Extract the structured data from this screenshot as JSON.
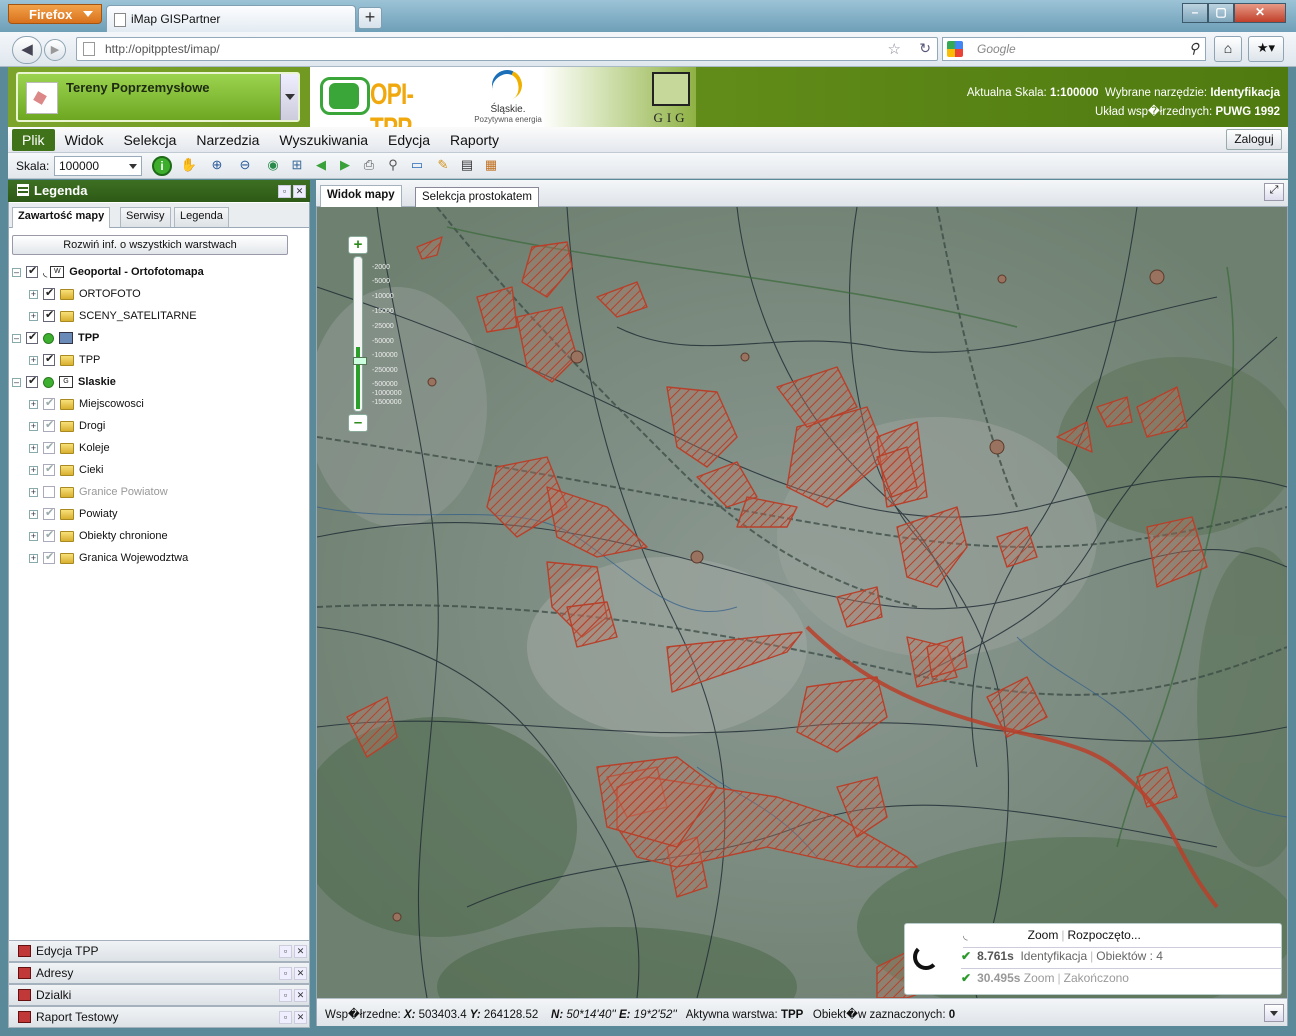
{
  "browser": {
    "app_button": "Firefox",
    "tab_title": "iMap GISPartner",
    "new_tab": "+",
    "url": "http://opitpptest/imap/",
    "search_placeholder": "Google"
  },
  "header": {
    "layer_selector": "Tereny Poprzemysłowe",
    "logo_opi": "OPI-TPP",
    "logo_slaskie_1": "Śląskie.",
    "logo_slaskie_2": "Pozytywna energia",
    "logo_gig": "GIG",
    "scale_label": "Aktualna Skala:",
    "scale_value": "1:100000",
    "tool_label": "Wybrane narzędzie:",
    "tool_value": "Identyfikacja",
    "crs_label": "Układ wsp�łrzednych:",
    "crs_value": "PUWG 1992"
  },
  "menu": {
    "items": [
      "Plik",
      "Widok",
      "Selekcja",
      "Narzedzia",
      "Wyszukiwania",
      "Edycja",
      "Raporty"
    ],
    "login": "Zaloguj"
  },
  "toolbar": {
    "scale_label": "Skala:",
    "scale_value": "100000"
  },
  "legend": {
    "title": "Legenda",
    "tabs": [
      "Zawartość mapy",
      "Serwisy",
      "Legenda"
    ],
    "expand_button": "Rozwiń inf. o wszystkich warstwach",
    "groups": [
      {
        "label": "Geoportal - Ortofotomapa",
        "children": [
          "ORTOFOTO",
          "SCENY_SATELITARNE"
        ]
      },
      {
        "label": "TPP",
        "children": [
          "TPP"
        ]
      },
      {
        "label": "Slaskie",
        "children": [
          "Miejscowosci",
          "Drogi",
          "Koleje",
          "Cieki",
          "Granice Powiatow",
          "Powiaty",
          "Obiekty chronione",
          "Granica Wojewodztwa"
        ]
      }
    ]
  },
  "bottom_panels": [
    "Edycja TPP",
    "Adresy",
    "Dzialki",
    "Raport Testowy"
  ],
  "map": {
    "tabs": [
      "Widok mapy",
      "Selekcja prostokatem"
    ],
    "zoom_labels": [
      "-2000",
      "-5000",
      "-10000",
      "-15000",
      "-25000",
      "-50000",
      "-100000",
      "-250000",
      "-500000",
      "-1000000",
      "-1500000"
    ],
    "zoom_level_fraction": 0.4
  },
  "status": {
    "coord_label": "Wsp�łrzedne:",
    "x_label": "X:",
    "x_value": "503403.4",
    "y_label": "Y:",
    "y_value": "264128.52",
    "n_label": "N:",
    "n_value": "50*14'40''",
    "e_label": "E:",
    "e_value": "19*2'52''",
    "active_layer_label": "Aktywna warstwa:",
    "active_layer_value": "TPP",
    "selected_label": "Obiekt�w zaznaczonych:",
    "selected_value": "0"
  },
  "notifications": {
    "row0_op": "Zoom",
    "row0_status": "Rozpoczęto...",
    "row1_time": "8.761s",
    "row1_op": "Identyfikacja",
    "row1_status": "Obiektów : 4",
    "row2_time": "30.495s",
    "row2_op": "Zoom",
    "row2_status": "Zakończono"
  },
  "colors": {
    "header_green": "#5f8a18",
    "menu_active": "#3f7219",
    "tpp_polygon": "#b8402a"
  }
}
